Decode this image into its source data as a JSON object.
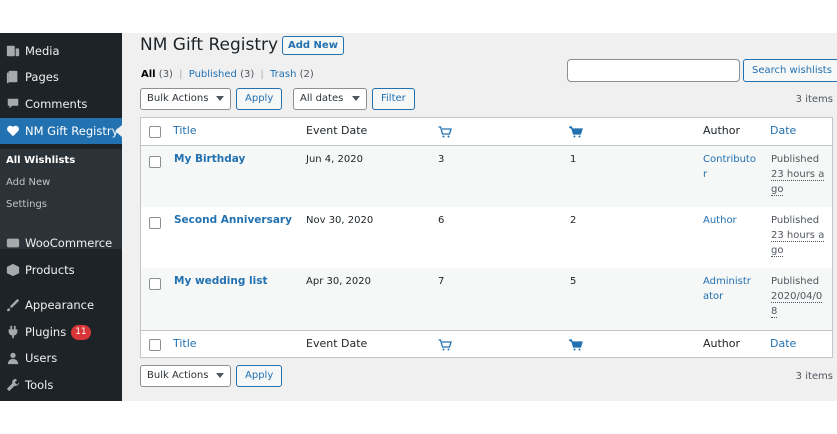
{
  "sidebar": {
    "items": [
      {
        "label": "Media",
        "icon": "media-icon"
      },
      {
        "label": "Pages",
        "icon": "pages-icon"
      },
      {
        "label": "Comments",
        "icon": "comments-icon"
      },
      {
        "label": "NM Gift Registry",
        "icon": "heart-icon"
      },
      {
        "label": "WooCommerce",
        "icon": "woocommerce-icon"
      },
      {
        "label": "Products",
        "icon": "products-icon"
      },
      {
        "label": "Appearance",
        "icon": "appearance-icon"
      },
      {
        "label": "Plugins",
        "icon": "plugins-icon",
        "badge": "11"
      },
      {
        "label": "Users",
        "icon": "users-icon"
      },
      {
        "label": "Tools",
        "icon": "tools-icon"
      }
    ],
    "submenu": [
      "All Wishlists",
      "Add New",
      "Settings"
    ]
  },
  "header": {
    "title": "NM Gift Registry",
    "add_new": "Add New"
  },
  "views": {
    "all": "All",
    "all_count": "(3)",
    "published": "Published",
    "published_count": "(3)",
    "trash": "Trash",
    "trash_count": "(2)",
    "sep": "|"
  },
  "search": {
    "value": "",
    "button": "Search wishlists"
  },
  "top_nav": {
    "bulk": "Bulk Actions",
    "apply": "Apply",
    "dates": "All dates",
    "filter": "Filter",
    "count": "3 items"
  },
  "bottom_nav": {
    "bulk": "Bulk Actions",
    "apply": "Apply",
    "count": "3 items"
  },
  "columns": {
    "title": "Title",
    "event_date": "Event Date",
    "author": "Author",
    "date": "Date",
    "cart_icon": "cart-outline-icon",
    "cart_filled_icon": "cart-filled-icon"
  },
  "rows": [
    {
      "title": "My Birthday",
      "event_date": "Jun 4, 2020",
      "col_a": "3",
      "col_b": "1",
      "author": "Contributor",
      "status": "Published",
      "date": "23 hours ago"
    },
    {
      "title": "Second Anniversary",
      "event_date": "Nov 30, 2020",
      "col_a": "6",
      "col_b": "2",
      "author": "Author",
      "status": "Published",
      "date": "23 hours ago"
    },
    {
      "title": "My wedding list",
      "event_date": "Apr 30, 2020",
      "col_a": "7",
      "col_b": "5",
      "author": "Administrator",
      "status": "Published",
      "date": "2020/04/08"
    }
  ],
  "colors": {
    "sidebar": "#1d2327",
    "accent": "#2271b1",
    "badge": "#d63638"
  }
}
